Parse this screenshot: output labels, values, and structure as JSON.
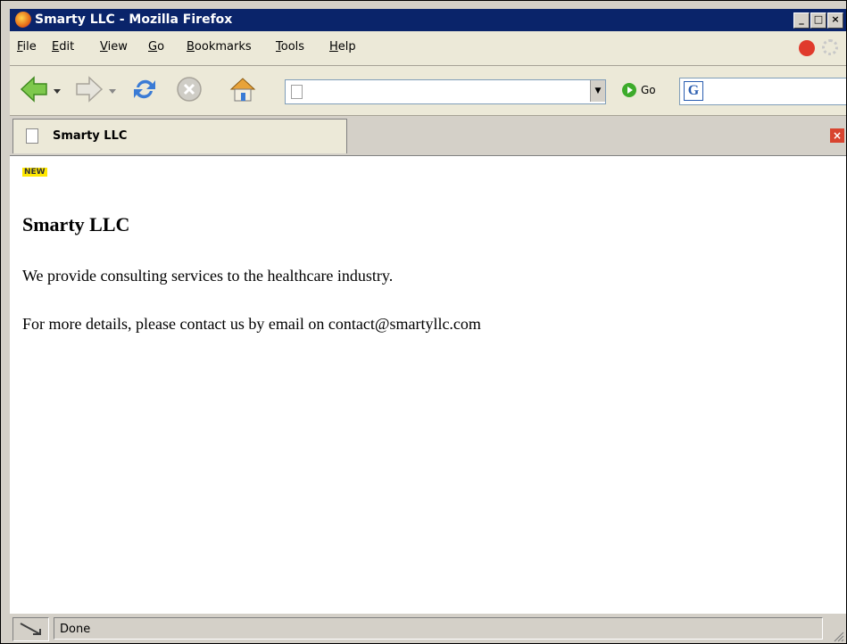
{
  "window": {
    "title": "Smarty LLC - Mozilla Firefox"
  },
  "titlebar_buttons": {
    "minimize": "_",
    "maximize": "□",
    "close": "×"
  },
  "menu": [
    {
      "label": "File",
      "u": "F",
      "rest": "ile"
    },
    {
      "label": "Edit",
      "u": "E",
      "rest": "dit"
    },
    {
      "label": "View",
      "u": "V",
      "rest": "iew"
    },
    {
      "label": "Go",
      "u": "G",
      "rest": "o"
    },
    {
      "label": "Bookmarks",
      "u": "B",
      "rest": "ookmarks"
    },
    {
      "label": "Tools",
      "u": "T",
      "rest": "ools"
    },
    {
      "label": "Help",
      "u": "H",
      "rest": "elp"
    }
  ],
  "toolbar": {
    "icons": [
      "back-icon",
      "forward-icon",
      "reload-icon",
      "stop-icon",
      "home-icon"
    ],
    "url_value": "",
    "go_label": "Go"
  },
  "tab": {
    "label": "Smarty LLC"
  },
  "page": {
    "badge": "NEW",
    "heading": "Smarty LLC",
    "paragraph1": "We provide consulting services to the healthcare industry.",
    "paragraph2": "For more details, please contact us by email on contact@smartyllc.com"
  },
  "status": {
    "text": "Done"
  },
  "colors": {
    "titlebar": "#0a246a",
    "badge": "#ffe800",
    "go": "#3dab2b",
    "tab_close": "#d8442f"
  }
}
